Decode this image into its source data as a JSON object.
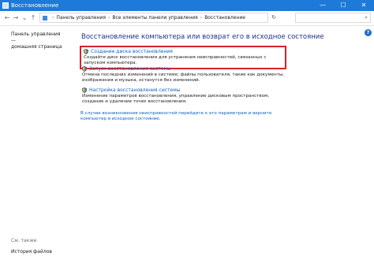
{
  "window": {
    "title": "Восстановление",
    "controls": {
      "minimize": "—",
      "maximize": "☐",
      "close": "✕"
    }
  },
  "nav": {
    "back": "←",
    "forward": "→",
    "recent": "⌄",
    "up": "↑",
    "refresh": "↻",
    "breadcrumb": [
      "Панель управления",
      "Все элементы панели управления",
      "Восстановление"
    ],
    "breadcrumb_sep": "›"
  },
  "search": {
    "placeholder": ""
  },
  "sidebar": {
    "home_link_line1": "Панель управления —",
    "home_link_line2": "домашняя страница",
    "see_also": "См. также",
    "file_history": "История файлов"
  },
  "help": {
    "label": "?"
  },
  "main": {
    "heading": "Восстановление компьютера или возврат его в исходное состояние",
    "options": [
      {
        "title": "Создание диска восстановления",
        "description": "Создайте диск восстановления для устранения неисправностей, связанных с запуском компьютера."
      },
      {
        "title": "Запуск восстановления системы",
        "description": "Отмена последних изменений в системе; файлы пользователя, такие как документы, изображения и музыка, останутся без изменений."
      },
      {
        "title": "Настройка восстановления системы",
        "description": "Изменение параметров восстановления, управление дисковым пространством, создание и удаление точек восстановления."
      }
    ],
    "footer_link": "В случае возникновения неисправностей перейдите к его параметрам и верните компьютер в исходное состояние."
  },
  "colors": {
    "titlebar": "#1d7ad9",
    "link": "#0d61c4",
    "heading": "#1e3287",
    "highlight": "#d9222a"
  },
  "icons": {
    "option_icon": "shield-icon",
    "search": "search-icon"
  }
}
